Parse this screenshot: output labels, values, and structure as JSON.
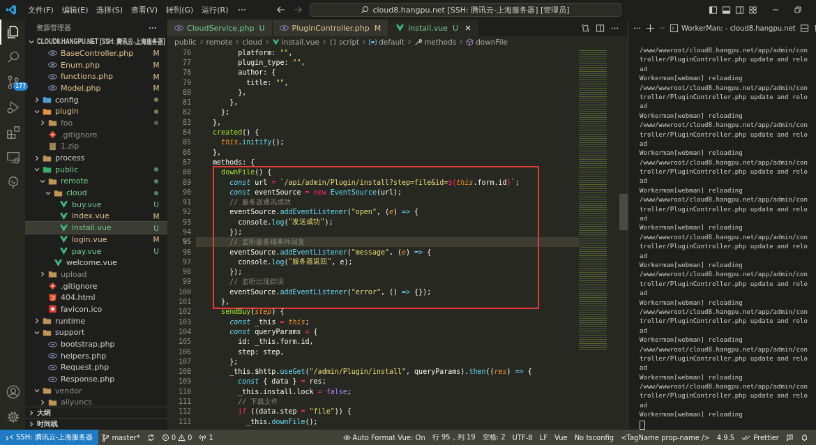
{
  "title_bar": {
    "menus": [
      "文件(F)",
      "编辑(E)",
      "选择(S)",
      "查看(V)",
      "转到(G)",
      "运行(R)"
    ],
    "command_center": "cloud8.hangpu.net [SSH: 腾讯云-上海服务器] [管理员]"
  },
  "activity_bar": [
    {
      "kind": "explorer",
      "selected": true
    },
    {
      "kind": "search",
      "selected": false
    },
    {
      "kind": "source-control",
      "selected": false,
      "badge": "177"
    },
    {
      "kind": "run",
      "selected": false
    },
    {
      "kind": "extensions",
      "selected": false
    },
    {
      "kind": "remote",
      "selected": false
    },
    {
      "kind": "tree",
      "selected": false
    }
  ],
  "activity_bar_bottom": [
    {
      "kind": "account"
    },
    {
      "kind": "settings"
    }
  ],
  "sidebar": {
    "title": "资源管理器",
    "root": {
      "label": "CLOUD8.HANGPU.NET [SSH: 腾讯云-上海服务器]",
      "expanded": true
    },
    "partial_files": [
      {
        "name": "BaseController.php",
        "kind": "php",
        "color": "#e2c08d",
        "badge": "M",
        "selected": false
      },
      {
        "name": "Enum.php",
        "kind": "php",
        "color": "#e2c08d",
        "badge": "M",
        "selected": false
      },
      {
        "name": "functions.php",
        "kind": "php",
        "color": "#e2c08d",
        "badge": "M",
        "selected": false
      },
      {
        "name": "Model.php",
        "kind": "php",
        "color": "#e2c08d",
        "badge": "M",
        "selected": false
      }
    ],
    "tree": [
      {
        "name": "config",
        "kind": "folder-config",
        "color": "#cccccc",
        "expanded": false,
        "selected": false,
        "dot": {
          "color": "#8a7a58"
        }
      },
      {
        "name": "plugin",
        "kind": "folder-plugin",
        "color": "#e2c08d",
        "expanded": true,
        "selected": false,
        "dot": {
          "color": "#8a7a58"
        },
        "children": [
          {
            "name": "foo",
            "kind": "folder",
            "color": "#8c8c8c",
            "expanded": false,
            "selected": false,
            "dot": {
              "color": "#5c5c5c"
            }
          },
          {
            "name": ".gitignore",
            "kind": "git",
            "color": "#8c8c8c",
            "selected": false
          },
          {
            "name": "1.zip",
            "kind": "zip",
            "color": "#8c8c8c",
            "selected": false
          }
        ]
      },
      {
        "name": "process",
        "kind": "folder",
        "color": "#cccccc",
        "expanded": false,
        "selected": false
      },
      {
        "name": "public",
        "kind": "folder-public",
        "color": "#73c991",
        "expanded": true,
        "selected": false,
        "dot": {
          "color": "#4f8a5e"
        },
        "children": [
          {
            "name": "remote",
            "kind": "folder",
            "color": "#73c991",
            "expanded": true,
            "selected": false,
            "dot": {
              "color": "#4f8a5e"
            },
            "children": [
              {
                "name": "cloud",
                "kind": "folder",
                "color": "#73c991",
                "expanded": true,
                "selected": false,
                "dot": {
                  "color": "#4f8a5e"
                },
                "children": [
                  {
                    "name": "buy.vue",
                    "kind": "vue",
                    "color": "#73c991",
                    "badge": "U",
                    "selected": false
                  },
                  {
                    "name": "index.vue",
                    "kind": "vue",
                    "color": "#e2c08d",
                    "badge": "M",
                    "selected": false
                  },
                  {
                    "name": "install.vue",
                    "kind": "vue",
                    "color": "#73c991",
                    "badge": "U",
                    "selected": true
                  },
                  {
                    "name": "login.vue",
                    "kind": "vue",
                    "color": "#e2c08d",
                    "badge": "M",
                    "selected": false
                  },
                  {
                    "name": "pay.vue",
                    "kind": "vue",
                    "color": "#73c991",
                    "badge": "U",
                    "selected": false
                  }
                ]
              },
              {
                "name": "welcome.vue",
                "kind": "vue",
                "color": "#cccccc",
                "selected": false
              }
            ]
          },
          {
            "name": "upload",
            "kind": "folder",
            "color": "#8c8c8c",
            "expanded": false,
            "selected": false
          },
          {
            "name": ".gitignore",
            "kind": "git",
            "color": "#cccccc",
            "selected": false
          },
          {
            "name": "404.html",
            "kind": "html",
            "color": "#cccccc",
            "selected": false
          },
          {
            "name": "favicon.ico",
            "kind": "star",
            "color": "#cccccc",
            "selected": false
          }
        ]
      },
      {
        "name": "runtime",
        "kind": "folder",
        "color": "#cccccc",
        "expanded": false,
        "selected": false
      },
      {
        "name": "support",
        "kind": "folder",
        "color": "#cccccc",
        "expanded": true,
        "selected": false,
        "children": [
          {
            "name": "bootstrap.php",
            "kind": "php",
            "color": "#cccccc",
            "selected": false
          },
          {
            "name": "helpers.php",
            "kind": "php",
            "color": "#cccccc",
            "selected": false
          },
          {
            "name": "Request.php",
            "kind": "php",
            "color": "#cccccc",
            "selected": false
          },
          {
            "name": "Response.php",
            "kind": "php",
            "color": "#cccccc",
            "selected": false
          }
        ]
      },
      {
        "name": "vendor",
        "kind": "folder",
        "color": "#8c8c8c",
        "expanded": true,
        "selected": false,
        "children": [
          {
            "name": "aliyuncs",
            "kind": "folder",
            "color": "#8c8c8c",
            "expanded": false,
            "selected": false
          }
        ]
      }
    ],
    "sections": [
      {
        "label": "大纲",
        "expanded": false
      },
      {
        "label": "时间线",
        "expanded": false
      }
    ]
  },
  "tabs": [
    {
      "label": "CloudService.php",
      "kind": "php",
      "color": "#73c991",
      "badge": "U",
      "selected": false
    },
    {
      "label": "PluginController.php",
      "kind": "php",
      "color": "#e2c08d",
      "badge": "M",
      "selected": false
    },
    {
      "label": "install.vue",
      "kind": "vue",
      "color": "#73c991",
      "badge": "U",
      "selected": true
    }
  ],
  "breadcrumb": [
    {
      "kind": "folder",
      "text": "public"
    },
    {
      "kind": "folder",
      "text": "remote"
    },
    {
      "kind": "folder",
      "text": "cloud"
    },
    {
      "kind": "vue",
      "text": "install.vue"
    },
    {
      "kind": "braces",
      "text": "script"
    },
    {
      "kind": "module",
      "text": "default"
    },
    {
      "kind": "method",
      "text": "methods"
    },
    {
      "kind": "function",
      "text": "downFile"
    }
  ],
  "editor": {
    "lines": [
      {
        "no": "76",
        "current": false,
        "marked": false,
        "tokens": [
          {
            "kind": "text",
            "text": "          platform: "
          },
          {
            "kind": "string",
            "text": "\"\""
          },
          {
            "kind": "text",
            "text": ","
          }
        ]
      },
      {
        "no": "77",
        "current": false,
        "marked": false,
        "tokens": [
          {
            "kind": "text",
            "text": "          plugin_type: "
          },
          {
            "kind": "string",
            "text": "\"\""
          },
          {
            "kind": "text",
            "text": ","
          }
        ]
      },
      {
        "no": "78",
        "current": false,
        "marked": false,
        "tokens": [
          {
            "kind": "text",
            "text": "          author: {"
          }
        ]
      },
      {
        "no": "79",
        "current": false,
        "marked": false,
        "tokens": [
          {
            "kind": "text",
            "text": "            title: "
          },
          {
            "kind": "string",
            "text": "\"\""
          },
          {
            "kind": "text",
            "text": ","
          }
        ]
      },
      {
        "no": "80",
        "current": false,
        "marked": false,
        "tokens": [
          {
            "kind": "text",
            "text": "          },"
          }
        ]
      },
      {
        "no": "81",
        "current": false,
        "marked": false,
        "tokens": [
          {
            "kind": "text",
            "text": "        },"
          }
        ]
      },
      {
        "no": "82",
        "current": false,
        "marked": false,
        "tokens": [
          {
            "kind": "text",
            "text": "      };"
          }
        ]
      },
      {
        "no": "83",
        "current": false,
        "marked": false,
        "tokens": [
          {
            "kind": "text",
            "text": "    },"
          }
        ]
      },
      {
        "no": "84",
        "current": false,
        "marked": false,
        "tokens": [
          {
            "kind": "entity",
            "text": "    created"
          },
          {
            "kind": "text",
            "text": "() {"
          }
        ]
      },
      {
        "no": "85",
        "current": false,
        "marked": false,
        "tokens": [
          {
            "kind": "this",
            "text": "      this"
          },
          {
            "kind": "text",
            "text": "."
          },
          {
            "kind": "support",
            "text": "initify"
          },
          {
            "kind": "text",
            "text": "();"
          }
        ]
      },
      {
        "no": "86",
        "current": false,
        "marked": false,
        "tokens": [
          {
            "kind": "text",
            "text": "    },"
          }
        ]
      },
      {
        "no": "87",
        "current": false,
        "marked": false,
        "tokens": [
          {
            "kind": "text",
            "text": "    methods: {"
          }
        ]
      },
      {
        "no": "88",
        "current": false,
        "marked": true,
        "tokens": [
          {
            "kind": "entity",
            "text": "      downFile"
          },
          {
            "kind": "text",
            "text": "() {"
          }
        ]
      },
      {
        "no": "89",
        "current": false,
        "marked": true,
        "tokens": [
          {
            "kind": "storage",
            "text": "        const"
          },
          {
            "kind": "text",
            "text": " url "
          },
          {
            "kind": "operator",
            "text": "="
          },
          {
            "kind": "string",
            "text": " `/api/admin/Plugin/install?step=file&id="
          },
          {
            "kind": "operator",
            "text": "${"
          },
          {
            "kind": "this",
            "text": "this"
          },
          {
            "kind": "text",
            "text": ".form.id"
          },
          {
            "kind": "operator",
            "text": "}"
          },
          {
            "kind": "string",
            "text": "`"
          },
          {
            "kind": "text",
            "text": ";"
          }
        ]
      },
      {
        "no": "90",
        "current": false,
        "marked": true,
        "tokens": [
          {
            "kind": "storage",
            "text": "        const"
          },
          {
            "kind": "text",
            "text": " eventSource "
          },
          {
            "kind": "operator",
            "text": "="
          },
          {
            "kind": "operator",
            "text": " new"
          },
          {
            "kind": "support",
            "text": " EventSource"
          },
          {
            "kind": "text",
            "text": "(url);"
          }
        ]
      },
      {
        "no": "91",
        "current": false,
        "marked": true,
        "tokens": [
          {
            "kind": "comment",
            "text": "        // 服务器通讯成功"
          }
        ]
      },
      {
        "no": "92",
        "current": false,
        "marked": true,
        "tokens": [
          {
            "kind": "text",
            "text": "        eventSource."
          },
          {
            "kind": "support",
            "text": "addEventListener"
          },
          {
            "kind": "text",
            "text": "("
          },
          {
            "kind": "string",
            "text": "\"open\""
          },
          {
            "kind": "text",
            "text": ", ("
          },
          {
            "kind": "param",
            "text": "e"
          },
          {
            "kind": "text",
            "text": ") "
          },
          {
            "kind": "support",
            "text": "=>"
          },
          {
            "kind": "text",
            "text": " {"
          }
        ]
      },
      {
        "no": "93",
        "current": false,
        "marked": true,
        "tokens": [
          {
            "kind": "text",
            "text": "          console."
          },
          {
            "kind": "support",
            "text": "log"
          },
          {
            "kind": "text",
            "text": "("
          },
          {
            "kind": "string",
            "text": "\"发送成功\""
          },
          {
            "kind": "text",
            "text": ");"
          }
        ]
      },
      {
        "no": "94",
        "current": false,
        "marked": true,
        "tokens": [
          {
            "kind": "text",
            "text": "        });"
          }
        ]
      },
      {
        "no": "95",
        "current": true,
        "marked": true,
        "tokens": [
          {
            "kind": "comment",
            "text": "        // 监听服务端事件回复"
          }
        ]
      },
      {
        "no": "96",
        "current": false,
        "marked": true,
        "tokens": [
          {
            "kind": "text",
            "text": "        eventSource."
          },
          {
            "kind": "support",
            "text": "addEventListener"
          },
          {
            "kind": "text",
            "text": "("
          },
          {
            "kind": "string",
            "text": "\"message\""
          },
          {
            "kind": "text",
            "text": ", ("
          },
          {
            "kind": "param",
            "text": "e"
          },
          {
            "kind": "text",
            "text": ") "
          },
          {
            "kind": "support",
            "text": "=>"
          },
          {
            "kind": "text",
            "text": " {"
          }
        ]
      },
      {
        "no": "97",
        "current": false,
        "marked": true,
        "tokens": [
          {
            "kind": "text",
            "text": "          console."
          },
          {
            "kind": "support",
            "text": "log"
          },
          {
            "kind": "text",
            "text": "("
          },
          {
            "kind": "string",
            "text": "\"服务器返回\""
          },
          {
            "kind": "text",
            "text": ", e);"
          }
        ]
      },
      {
        "no": "98",
        "current": false,
        "marked": true,
        "tokens": [
          {
            "kind": "text",
            "text": "        });"
          }
        ]
      },
      {
        "no": "99",
        "current": false,
        "marked": true,
        "tokens": [
          {
            "kind": "comment",
            "text": "        // 监听出现错误"
          }
        ]
      },
      {
        "no": "100",
        "current": false,
        "marked": true,
        "tokens": [
          {
            "kind": "text",
            "text": "        eventSource."
          },
          {
            "kind": "support",
            "text": "addEventListener"
          },
          {
            "kind": "text",
            "text": "("
          },
          {
            "kind": "string",
            "text": "\"error\""
          },
          {
            "kind": "text",
            "text": ", () "
          },
          {
            "kind": "support",
            "text": "=>"
          },
          {
            "kind": "text",
            "text": " {});"
          }
        ]
      },
      {
        "no": "101",
        "current": false,
        "marked": true,
        "tokens": [
          {
            "kind": "text",
            "text": "      },"
          }
        ]
      },
      {
        "no": "102",
        "current": false,
        "marked": false,
        "tokens": [
          {
            "kind": "entity",
            "text": "      sendBuy"
          },
          {
            "kind": "text",
            "text": "("
          },
          {
            "kind": "param",
            "text": "step"
          },
          {
            "kind": "text",
            "text": ") {"
          }
        ]
      },
      {
        "no": "103",
        "current": false,
        "marked": false,
        "tokens": [
          {
            "kind": "storage",
            "text": "        const"
          },
          {
            "kind": "text",
            "text": " _this "
          },
          {
            "kind": "operator",
            "text": "="
          },
          {
            "kind": "this",
            "text": " this"
          },
          {
            "kind": "text",
            "text": ";"
          }
        ]
      },
      {
        "no": "104",
        "current": false,
        "marked": false,
        "tokens": [
          {
            "kind": "storage",
            "text": "        const"
          },
          {
            "kind": "text",
            "text": " queryParams "
          },
          {
            "kind": "operator",
            "text": "="
          },
          {
            "kind": "text",
            "text": " {"
          }
        ]
      },
      {
        "no": "105",
        "current": false,
        "marked": false,
        "tokens": [
          {
            "kind": "text",
            "text": "          id: _this.form.id,"
          }
        ]
      },
      {
        "no": "106",
        "current": false,
        "marked": false,
        "tokens": [
          {
            "kind": "text",
            "text": "          step: step,"
          }
        ]
      },
      {
        "no": "107",
        "current": false,
        "marked": false,
        "tokens": [
          {
            "kind": "text",
            "text": "        };"
          }
        ]
      },
      {
        "no": "108",
        "current": false,
        "marked": false,
        "tokens": [
          {
            "kind": "text",
            "text": "        _this.$http."
          },
          {
            "kind": "support",
            "text": "useGet"
          },
          {
            "kind": "text",
            "text": "("
          },
          {
            "kind": "string",
            "text": "\"/admin/Plugin/install\""
          },
          {
            "kind": "text",
            "text": ", queryParams)."
          },
          {
            "kind": "support",
            "text": "then"
          },
          {
            "kind": "text",
            "text": "(("
          },
          {
            "kind": "param",
            "text": "res"
          },
          {
            "kind": "text",
            "text": ") "
          },
          {
            "kind": "support",
            "text": "=>"
          },
          {
            "kind": "text",
            "text": " {"
          }
        ]
      },
      {
        "no": "109",
        "current": false,
        "marked": false,
        "tokens": [
          {
            "kind": "storage",
            "text": "          const"
          },
          {
            "kind": "text",
            "text": " { data } "
          },
          {
            "kind": "operator",
            "text": "="
          },
          {
            "kind": "text",
            "text": " res;"
          }
        ]
      },
      {
        "no": "110",
        "current": false,
        "marked": false,
        "tokens": [
          {
            "kind": "text",
            "text": "          _this.install.lock "
          },
          {
            "kind": "operator",
            "text": "="
          },
          {
            "kind": "constant",
            "text": " false"
          },
          {
            "kind": "text",
            "text": ";"
          }
        ]
      },
      {
        "no": "111",
        "current": false,
        "marked": false,
        "tokens": [
          {
            "kind": "comment",
            "text": "          // 下载文件"
          }
        ]
      },
      {
        "no": "112",
        "current": false,
        "marked": false,
        "tokens": [
          {
            "kind": "operator",
            "text": "          if"
          },
          {
            "kind": "text",
            "text": " ((data.step "
          },
          {
            "kind": "operator",
            "text": "="
          },
          {
            "kind": "string",
            "text": " \"file\""
          },
          {
            "kind": "text",
            "text": ")) {"
          }
        ]
      },
      {
        "no": "113",
        "current": false,
        "marked": false,
        "tokens": [
          {
            "kind": "text",
            "text": "            _this."
          },
          {
            "kind": "support",
            "text": "downFile"
          },
          {
            "kind": "text",
            "text": "();"
          }
        ]
      }
    ]
  },
  "terminal": {
    "title": "WorkerMan: - cloud8.hangpu.net",
    "lines": [
      "/www/wwwroot/cloud8.hangpu.net/app/admin/con",
      "troller/PluginController.php update and relo",
      "ad",
      "Workerman[webman] reloading",
      "/www/wwwroot/cloud8.hangpu.net/app/admin/con",
      "troller/PluginController.php update and relo",
      "ad",
      "Workerman[webman] reloading",
      "/www/wwwroot/cloud8.hangpu.net/app/admin/con",
      "troller/PluginController.php update and relo",
      "ad",
      "Workerman[webman] reloading",
      "/www/wwwroot/cloud8.hangpu.net/app/admin/con",
      "troller/PluginController.php update and relo",
      "ad",
      "Workerman[webman] reloading",
      "/www/wwwroot/cloud8.hangpu.net/app/admin/con",
      "troller/PluginController.php update and relo",
      "ad",
      "Workerman[webman] reloading",
      "/www/wwwroot/cloud8.hangpu.net/app/admin/con",
      "troller/PluginController.php update and relo",
      "ad",
      "Workerman[webman] reloading",
      "/www/wwwroot/cloud8.hangpu.net/app/admin/con",
      "troller/PluginController.php update and relo",
      "ad",
      "Workerman[webman] reloading",
      "/www/wwwroot/cloud8.hangpu.net/app/admin/con",
      "troller/PluginController.php update and relo",
      "ad",
      "Workerman[webman] reloading",
      "/www/wwwroot/cloud8.hangpu.net/app/admin/con",
      "troller/PluginController.php update and relo",
      "ad",
      "Workerman[webman] reloading",
      "/www/wwwroot/cloud8.hangpu.net/app/admin/con",
      "troller/PluginController.php update and relo",
      "ad",
      "Workerman[webman] reloading"
    ]
  },
  "status_bar": {
    "remote": "SSH: 腾讯云-上海服务器",
    "left": [
      {
        "kind": "branch",
        "text": "master*"
      },
      {
        "kind": "sync"
      },
      {
        "kind": "problems",
        "errors": "0",
        "warnings": "0"
      },
      {
        "kind": "ports",
        "text": "1"
      }
    ],
    "right": [
      {
        "kind": "eye",
        "text": "Auto Format Vue: On"
      },
      {
        "kind": "text",
        "text": "行 95，列 19"
      },
      {
        "kind": "text",
        "text": "空格: 2"
      },
      {
        "kind": "text",
        "text": "UTF-8"
      },
      {
        "kind": "text",
        "text": "LF"
      },
      {
        "kind": "text",
        "text": "Vue"
      },
      {
        "kind": "text",
        "text": "No tsconfig"
      },
      {
        "kind": "text",
        "text": "<TagName prop-name />"
      },
      {
        "kind": "text",
        "text": "4.9.5"
      },
      {
        "kind": "check",
        "text": "Prettier"
      },
      {
        "kind": "feedback"
      },
      {
        "kind": "bell"
      }
    ]
  }
}
